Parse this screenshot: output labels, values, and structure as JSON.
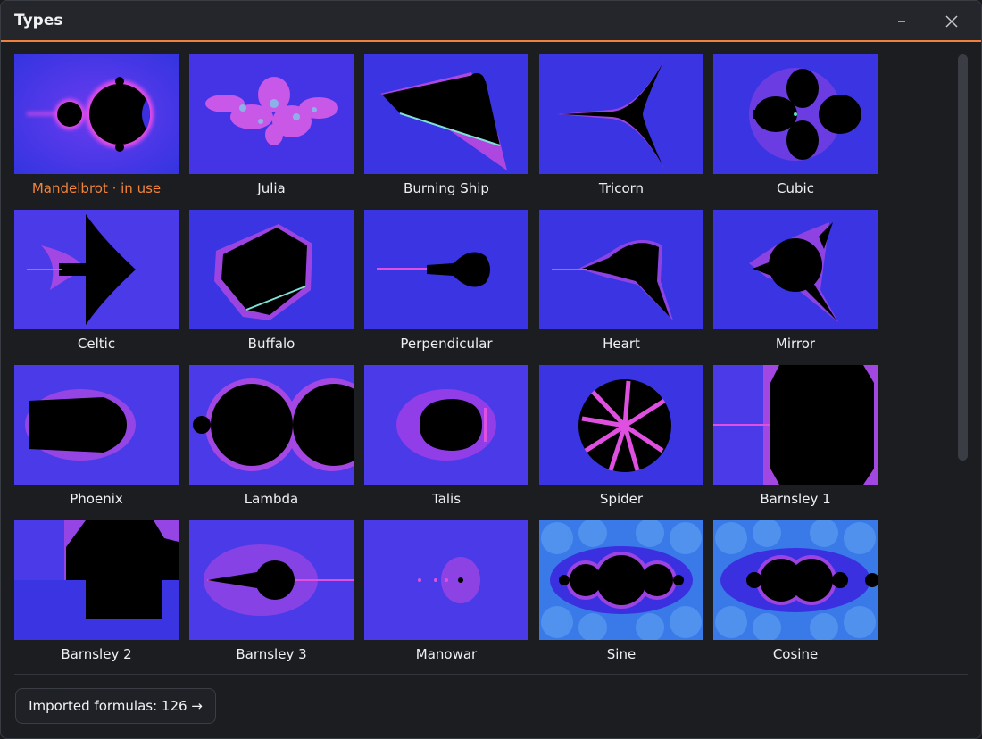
{
  "window": {
    "title": "Types"
  },
  "titlebar": {
    "minimize_icon": "minimize-icon",
    "close_icon": "close-icon"
  },
  "colors": {
    "accent": "#f0813c",
    "thumb_bg": "#3b31e8",
    "fractal_glow": "#e040e8",
    "fractal_fill": "#000000"
  },
  "types": [
    {
      "label": "Mandelbrot · in use",
      "active": true
    },
    {
      "label": "Julia"
    },
    {
      "label": "Burning Ship"
    },
    {
      "label": "Tricorn"
    },
    {
      "label": "Cubic"
    },
    {
      "label": "Celtic"
    },
    {
      "label": "Buffalo"
    },
    {
      "label": "Perpendicular"
    },
    {
      "label": "Heart"
    },
    {
      "label": "Mirror"
    },
    {
      "label": "Phoenix"
    },
    {
      "label": "Lambda"
    },
    {
      "label": "Talis"
    },
    {
      "label": "Spider"
    },
    {
      "label": "Barnsley 1"
    },
    {
      "label": "Barnsley 2"
    },
    {
      "label": "Barnsley 3"
    },
    {
      "label": "Manowar"
    },
    {
      "label": "Sine"
    },
    {
      "label": "Cosine"
    }
  ],
  "footer": {
    "imported_label": "Imported formulas: 126 →"
  }
}
